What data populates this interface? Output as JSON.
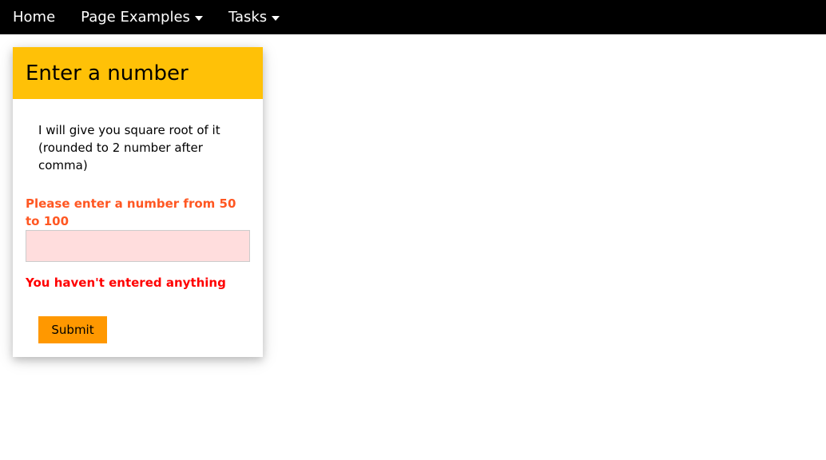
{
  "navbar": {
    "items": [
      {
        "label": "Home",
        "has_dropdown": false
      },
      {
        "label": "Page Examples",
        "has_dropdown": true
      },
      {
        "label": "Tasks",
        "has_dropdown": true
      }
    ]
  },
  "card": {
    "title": "Enter a number",
    "description": "I will give you square root of it (rounded to 2 number after comma)",
    "field_label": "Please enter a number from 50 to 100",
    "input_value": "",
    "error": "You haven't entered anything",
    "submit_label": "Submit"
  },
  "colors": {
    "navbar_bg": "#000000",
    "header_bg": "#ffc107",
    "label_color": "#ff5722",
    "error_color": "#ff0000",
    "input_bg": "#ffdddd",
    "button_bg": "#ff9800"
  }
}
